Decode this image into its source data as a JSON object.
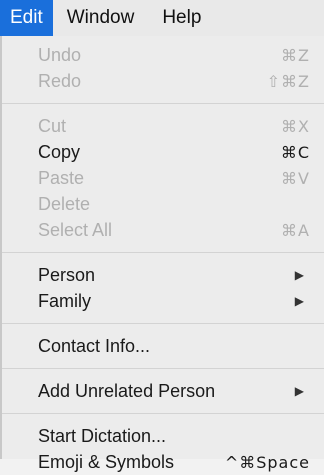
{
  "menubar": {
    "items": [
      "Edit",
      "Window",
      "Help"
    ]
  },
  "menu": {
    "undo": {
      "label": "Undo",
      "shortcut": "⌘Z"
    },
    "redo": {
      "label": "Redo",
      "shortcut": "⇧⌘Z"
    },
    "cut": {
      "label": "Cut",
      "shortcut": "⌘X"
    },
    "copy": {
      "label": "Copy",
      "shortcut": "⌘C"
    },
    "paste": {
      "label": "Paste",
      "shortcut": "⌘V"
    },
    "delete": {
      "label": "Delete"
    },
    "select_all": {
      "label": "Select All",
      "shortcut": "⌘A"
    },
    "person": {
      "label": "Person",
      "submenu_icon": "triangle-right-icon"
    },
    "family": {
      "label": "Family",
      "submenu_icon": "triangle-right-icon"
    },
    "contact_info": {
      "label": "Contact Info..."
    },
    "add_unrelated_person": {
      "label": "Add Unrelated Person",
      "submenu_icon": "triangle-right-icon"
    },
    "start_dictation": {
      "label": "Start Dictation..."
    },
    "emoji_symbols": {
      "label": "Emoji & Symbols",
      "shortcut": "^⌘Space"
    }
  },
  "colors": {
    "active_menu_bg": "#1a6fdb",
    "disabled_text": "#b0b0b0",
    "enabled_text": "#1a1a1a"
  }
}
